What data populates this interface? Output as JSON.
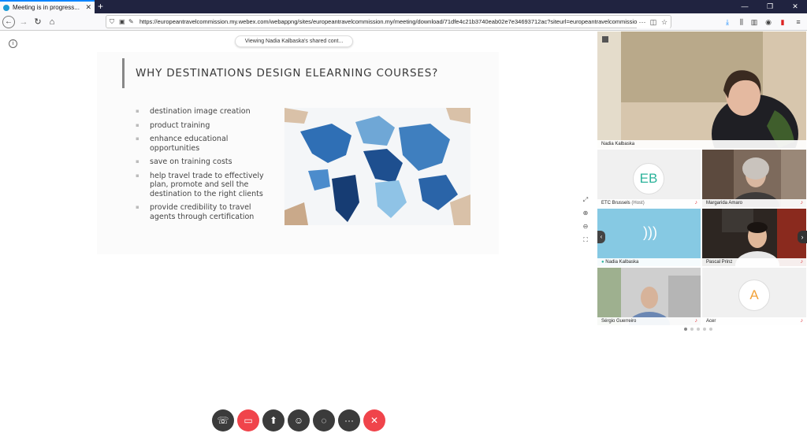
{
  "browser": {
    "tab_title": "Meeting is in progress...",
    "tab_close": "✕",
    "new_tab": "+",
    "url": "https://europeantravelcommission.my.webex.com/webappng/sites/europeantravelcommission.my/meeting/download/71dfe4c21b3740eab02e7e34693712ac?siteurl=europeantravelcommission",
    "window_controls": [
      "—",
      "❐",
      "✕"
    ],
    "nav_icons": [
      "back-icon",
      "forward-icon",
      "reload-icon",
      "home-icon"
    ]
  },
  "share_banner": "Viewing Nadia Kalbaska's shared cont...",
  "slide": {
    "title": "WHY DESTINATIONS DESIGN ELEARNING COURSES?",
    "bullets": [
      "destination image creation",
      "product training",
      "enhance educational opportunities",
      "save on training costs",
      "help travel trade to effectively plan, promote and sell the destination to the right clients",
      "provide credibility to travel agents through certification"
    ]
  },
  "participants": [
    {
      "name": "Nadia Kalbaska",
      "role": "",
      "avatar": "",
      "muted": false
    },
    {
      "name": "ETC Brussels",
      "role": "(Host)",
      "avatar": "EB",
      "muted": true
    },
    {
      "name": "Margarida Amaro",
      "role": "",
      "avatar": "",
      "muted": true
    },
    {
      "name": "Nadia Kalbaska",
      "role": "",
      "avatar": "",
      "muted": false
    },
    {
      "name": "Pascal Prinz",
      "role": "",
      "avatar": "",
      "muted": true
    },
    {
      "name": "Sérgio Guerreiro",
      "role": "",
      "avatar": "",
      "muted": true
    },
    {
      "name": "Acer",
      "role": "",
      "avatar": "A",
      "muted": true
    }
  ],
  "colors": {
    "accent_red": "#f0444b",
    "avatar_teal": "#2bb39b",
    "avatar_orange": "#f2a23a"
  },
  "controls": [
    "audio-icon",
    "video-icon",
    "share-icon",
    "participants-icon",
    "chat-icon",
    "more-icon",
    "leave-icon"
  ],
  "control_glyphs": {
    "audio": "☏",
    "video": "▭",
    "share": "⬆",
    "participants": "☺",
    "chat": "◌",
    "more": "···",
    "leave": "✕"
  },
  "page_dots": 5
}
